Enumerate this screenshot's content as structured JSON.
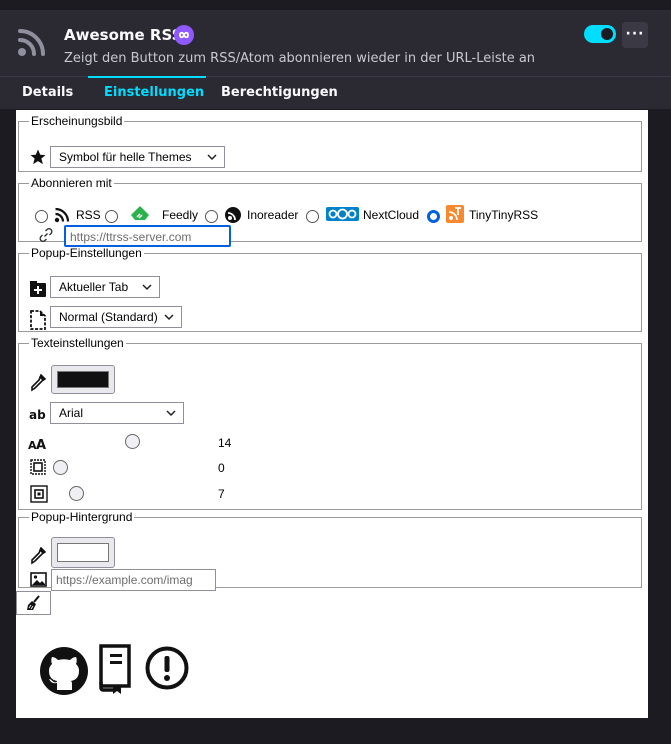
{
  "app": {
    "title": "Awesome RSS",
    "description": "Zeigt den Button zum RSS/Atom abonnieren wieder in der URL-Leiste an",
    "enabled": true,
    "more_label": "···"
  },
  "tabs": [
    {
      "label": "Details",
      "active": false
    },
    {
      "label": "Einstellungen",
      "active": true
    },
    {
      "label": "Berechtigungen",
      "active": false
    }
  ],
  "appearance": {
    "legend": "Erscheinungsbild",
    "icon_select": "Symbol für helle Themes"
  },
  "subscribe": {
    "legend": "Abonnieren mit",
    "options": [
      {
        "label": "RSS",
        "checked": false
      },
      {
        "label": "Feedly",
        "checked": false
      },
      {
        "label": "Inoreader",
        "checked": false
      },
      {
        "label": "NextCloud",
        "checked": false
      },
      {
        "label": "TinyTinyRSS",
        "checked": true
      }
    ],
    "server_placeholder": "https://ttrss-server.com"
  },
  "popup": {
    "legend": "Popup-Einstellungen",
    "open_select": "Aktueller Tab",
    "size_select": "Normal (Standard)"
  },
  "text": {
    "legend": "Texteinstellungen",
    "text_color": "#111111",
    "font_select": "Arial",
    "font_size_value": "14",
    "padding_value": "0",
    "spacing_value": "7"
  },
  "background": {
    "legend": "Popup-Hintergrund",
    "bg_color": "#ffffff",
    "image_placeholder": "https://example.com/imag"
  },
  "colors": {
    "accent": "#00ddff",
    "badge": "#9059ff",
    "radio_checked": "#0060df",
    "feedly": "#2bb24c",
    "nextcloud": "#0082c9",
    "ttrss": "#f78a31"
  },
  "footer_icons": [
    "github-icon",
    "book-icon",
    "exclamation-icon"
  ]
}
